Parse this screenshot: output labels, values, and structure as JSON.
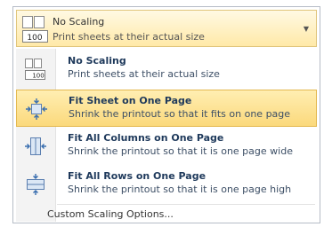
{
  "combo": {
    "title": "No Scaling",
    "subtitle": "Print sheets at their actual size",
    "badge": "100"
  },
  "menu": {
    "items": [
      {
        "title": "No Scaling",
        "desc": "Print sheets at their actual size",
        "badge": "100"
      },
      {
        "title": "Fit Sheet on One Page",
        "desc": "Shrink the printout so that it fits on one page"
      },
      {
        "title": "Fit All Columns on One Page",
        "desc": "Shrink the printout so that it is one page wide"
      },
      {
        "title": "Fit All Rows on One Page",
        "desc": "Shrink the printout so that it is one page high"
      }
    ],
    "custom": "Custom Scaling Options..."
  }
}
